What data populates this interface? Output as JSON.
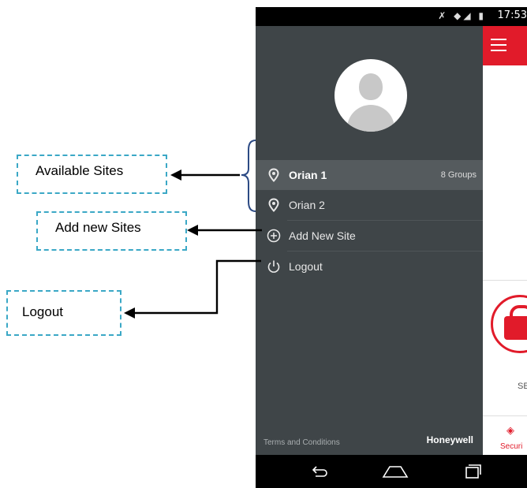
{
  "status_bar": {
    "time": "17:53"
  },
  "drawer": {
    "sites": [
      {
        "name": "Orian 1",
        "count": "8 Groups",
        "selected": true
      },
      {
        "name": "Orian 2",
        "count": "",
        "selected": false
      }
    ],
    "add_site_label": "Add New Site",
    "logout_label": "Logout",
    "terms_label": "Terms and Conditions",
    "brand_logo": "Honeywell"
  },
  "app": {
    "partial_label": "SE",
    "bottom_tab_label": "Securi"
  },
  "annotations": {
    "available_sites": "Available Sites",
    "add_new_sites": "Add new Sites",
    "logout": "Logout"
  },
  "colors": {
    "drawer_bg": "#3f4548",
    "selected_row": "#555b5e",
    "accent_red": "#e11b2a",
    "callout_border": "#3ba8c6"
  },
  "icons": [
    "location-pin-icon",
    "add-circle-icon",
    "power-icon",
    "menu-icon",
    "lock-icon",
    "shield-icon",
    "back-icon",
    "home-icon",
    "recents-icon"
  ]
}
